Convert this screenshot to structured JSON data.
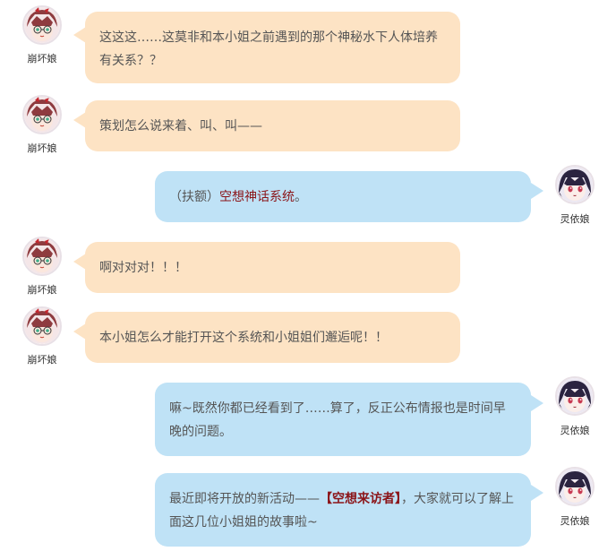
{
  "characters": {
    "honkai": {
      "name": "崩坏娘",
      "hair_color": "#8e3b3f",
      "eye_color": "#3fae8a"
    },
    "lingyi": {
      "name": "灵依娘",
      "hair_color": "#2b2440",
      "eye_color": "#c73a52"
    }
  },
  "colors": {
    "left_bubble": "#fde3c4",
    "right_bubble": "#bfe2f6",
    "highlight": "#8b1418"
  },
  "messages": [
    {
      "speaker": "崩坏娘",
      "text": "这这这……这莫非和本小姐之前遇到的那个神秘水下人体培养有关系？？"
    },
    {
      "speaker": "崩坏娘",
      "text": "策划怎么说来着、叫、叫——"
    },
    {
      "speaker": "灵依娘",
      "prefix": "（扶额）",
      "highlight": "空想神话系统",
      "suffix": "。"
    },
    {
      "speaker": "崩坏娘",
      "text": "啊对对对！！！"
    },
    {
      "speaker": "崩坏娘",
      "text": "本小姐怎么才能打开这个系统和小姐姐们邂逅呢！！"
    },
    {
      "speaker": "灵依娘",
      "text": "嘛~既然你都已经看到了……算了，反正公布情报也是时间早晚的问题。"
    },
    {
      "speaker": "灵依娘",
      "prefix": "最近即将开放的新活动——",
      "highlight": "【空想来访者】",
      "suffix": "，大家就可以了解上面这几位小姐姐的故事啦~"
    }
  ]
}
